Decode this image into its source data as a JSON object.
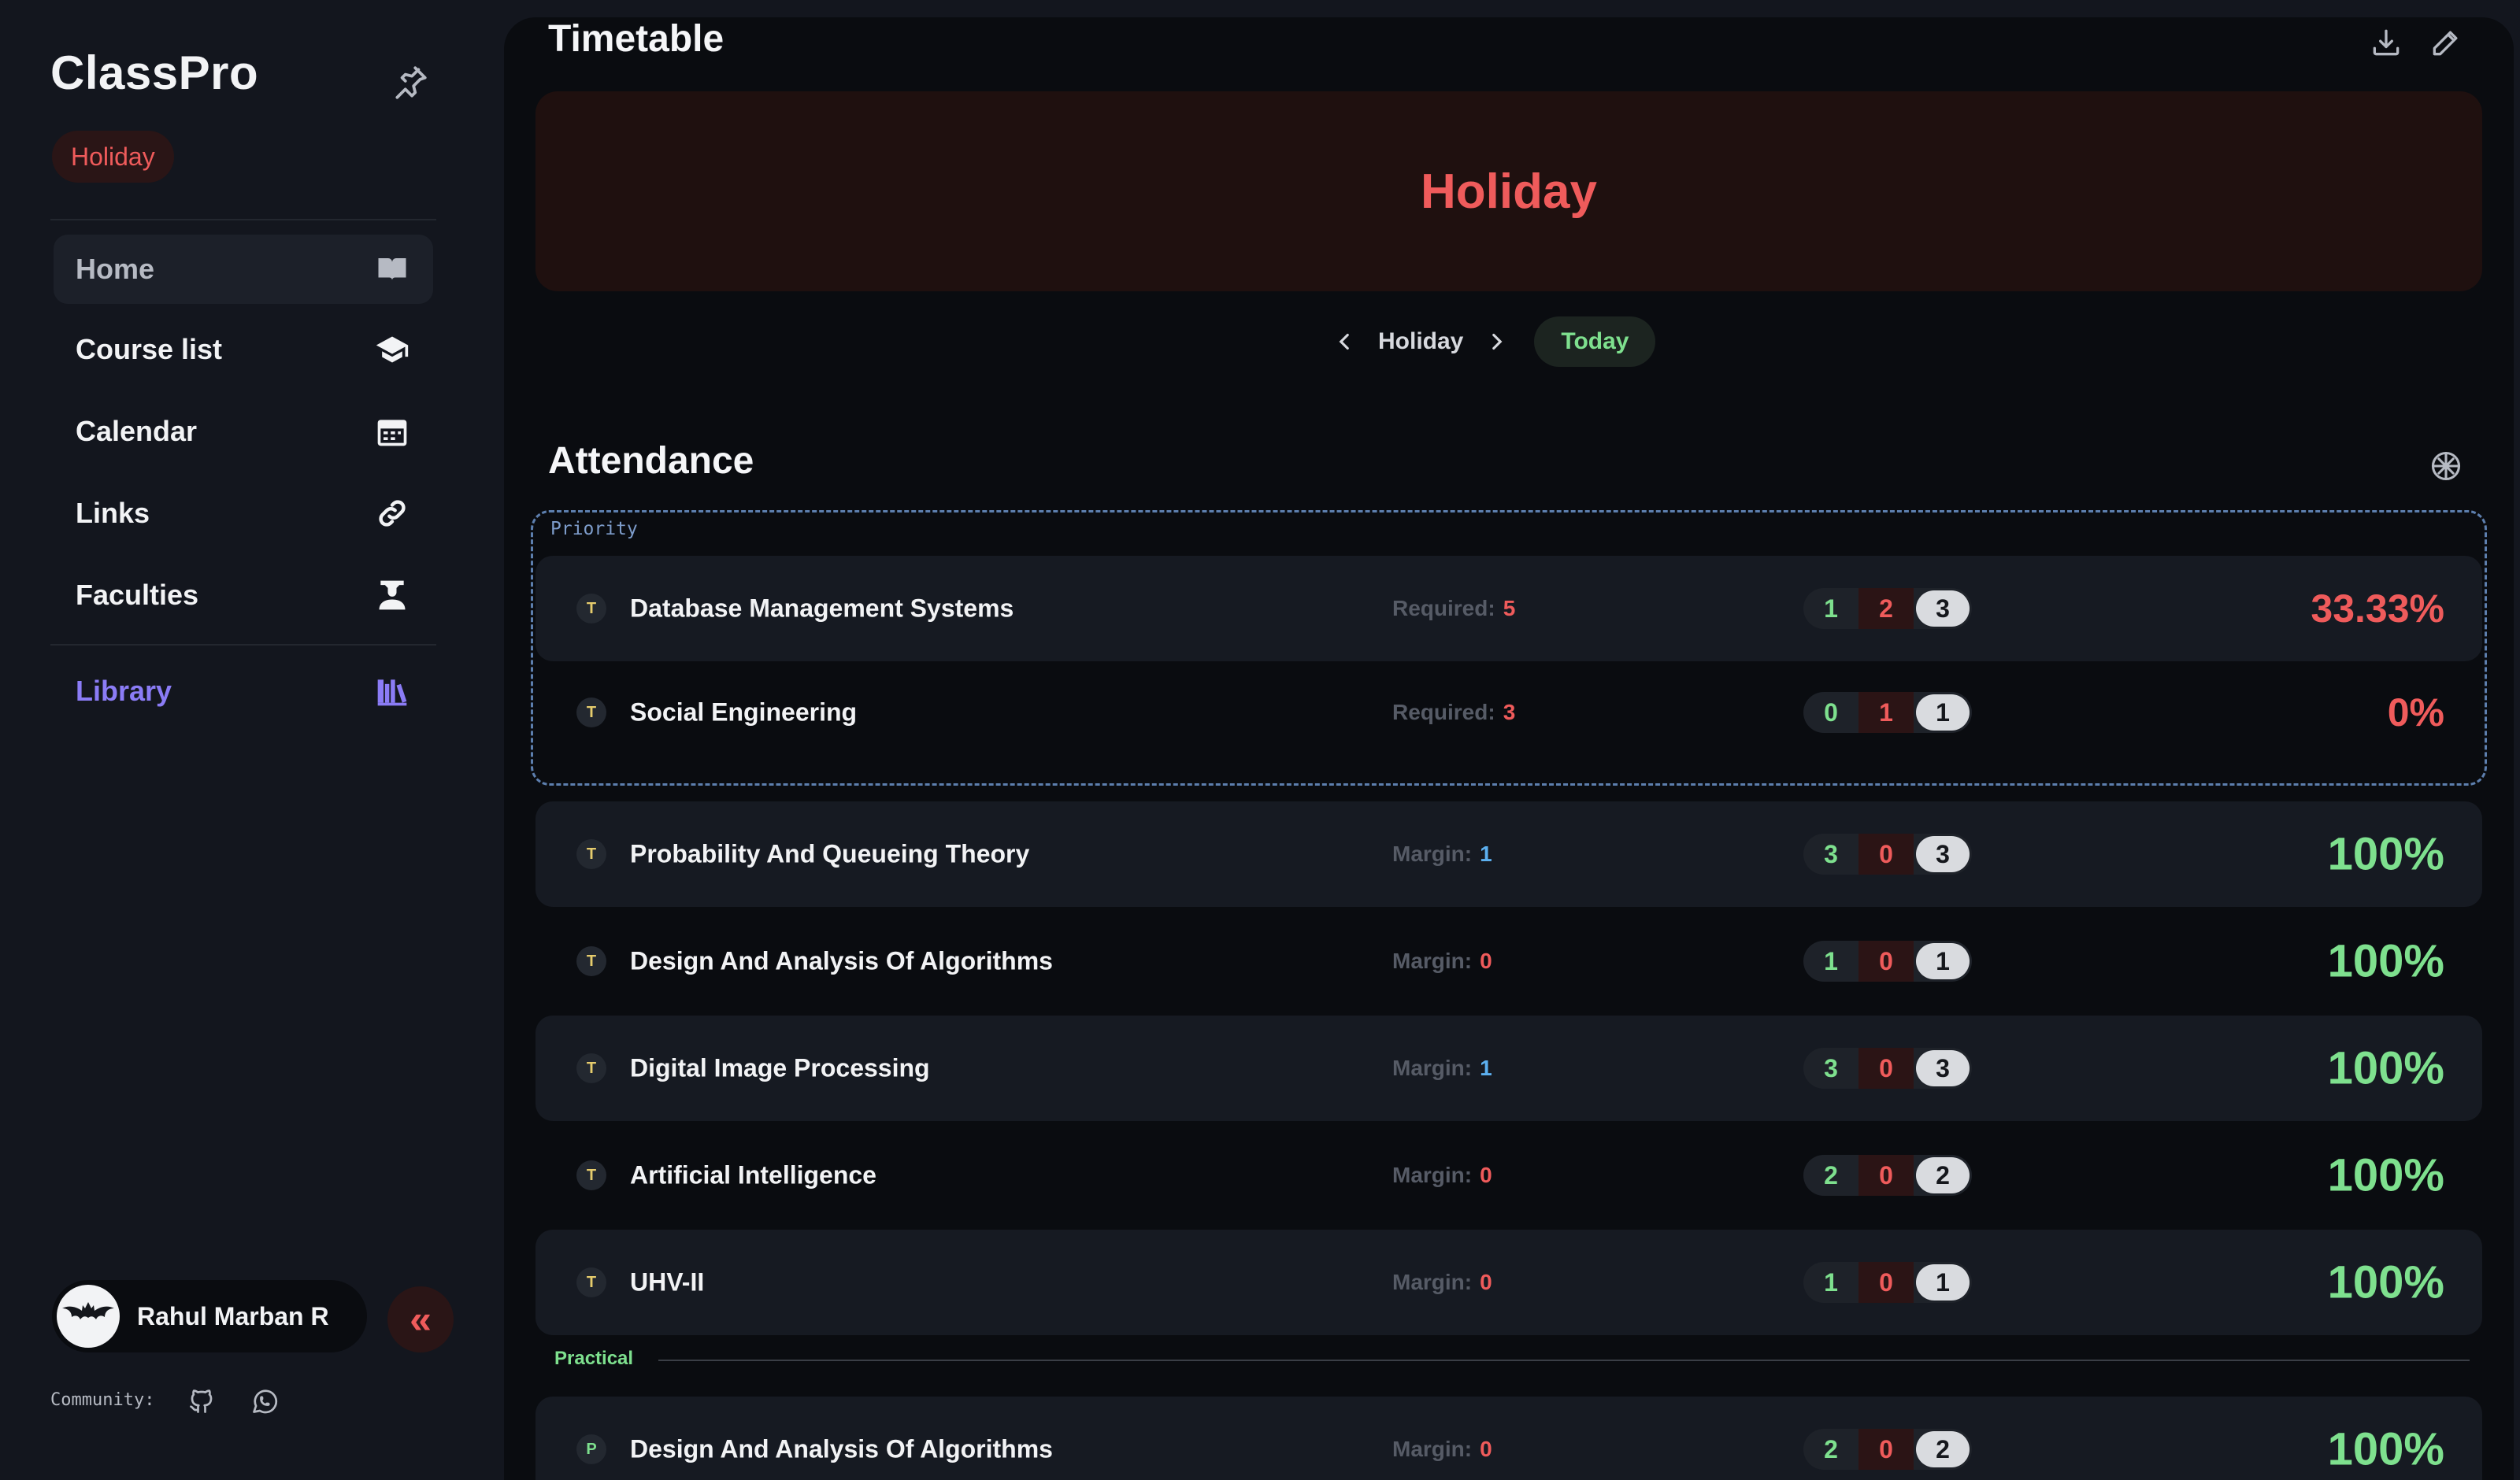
{
  "sidebar": {
    "brand": "ClassPro",
    "status_chip": "Holiday",
    "nav": [
      {
        "label": "Home",
        "icon": "book-open-icon"
      },
      {
        "label": "Course list",
        "icon": "graduation-cap-icon"
      },
      {
        "label": "Calendar",
        "icon": "calendar-icon"
      },
      {
        "label": "Links",
        "icon": "link-icon"
      },
      {
        "label": "Faculties",
        "icon": "teacher-icon"
      },
      {
        "label": "Library",
        "icon": "library-icon"
      }
    ],
    "user_name": "Rahul Marban R",
    "community_label": "Community:"
  },
  "timetable": {
    "title": "Timetable",
    "banner": "Holiday",
    "day_label": "Holiday",
    "today_button": "Today"
  },
  "attendance": {
    "title": "Attendance",
    "priority_label": "Priority",
    "practical_label": "Practical",
    "priority": [
      {
        "type": "T",
        "name": "Database Management Systems",
        "meta_label": "Required:",
        "meta_value": "5",
        "attended": "1",
        "absent": "2",
        "total": "3",
        "percent": "33.33%"
      },
      {
        "type": "T",
        "name": "Social Engineering",
        "meta_label": "Required:",
        "meta_value": "3",
        "attended": "0",
        "absent": "1",
        "total": "1",
        "percent": "0%"
      }
    ],
    "courses": [
      {
        "type": "T",
        "name": "Probability And Queueing Theory",
        "meta_label": "Margin:",
        "meta_value": "1",
        "attended": "3",
        "absent": "0",
        "total": "3",
        "percent": "100%"
      },
      {
        "type": "T",
        "name": "Design And Analysis Of Algorithms",
        "meta_label": "Margin:",
        "meta_value": "0",
        "attended": "1",
        "absent": "0",
        "total": "1",
        "percent": "100%"
      },
      {
        "type": "T",
        "name": "Digital Image Processing",
        "meta_label": "Margin:",
        "meta_value": "1",
        "attended": "3",
        "absent": "0",
        "total": "3",
        "percent": "100%"
      },
      {
        "type": "T",
        "name": "Artificial Intelligence",
        "meta_label": "Margin:",
        "meta_value": "0",
        "attended": "2",
        "absent": "0",
        "total": "2",
        "percent": "100%"
      },
      {
        "type": "T",
        "name": "UHV-II",
        "meta_label": "Margin:",
        "meta_value": "0",
        "attended": "1",
        "absent": "0",
        "total": "1",
        "percent": "100%"
      }
    ],
    "practical": [
      {
        "type": "P",
        "name": "Design And Analysis Of Algorithms",
        "meta_label": "Margin:",
        "meta_value": "0",
        "attended": "2",
        "absent": "0",
        "total": "2",
        "percent": "100%"
      }
    ]
  },
  "colors": {
    "accent_red": "#ef5b5b",
    "accent_green": "#7ee08e",
    "accent_purple": "#8b7cf6",
    "accent_blue": "#5cb0f0"
  }
}
